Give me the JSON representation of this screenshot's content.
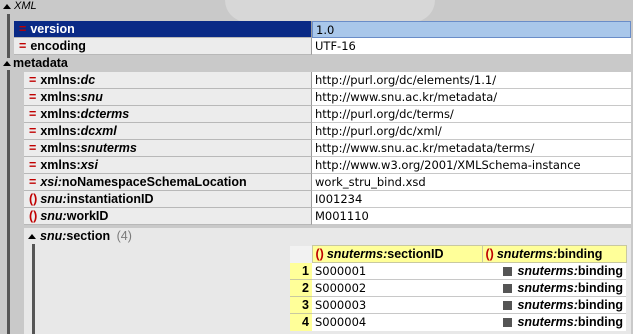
{
  "root": {
    "name": "XML"
  },
  "rows_top": [
    {
      "marker": "=",
      "prefix": "",
      "name": "version",
      "value": "1.0",
      "selected": true
    },
    {
      "marker": "=",
      "prefix": "",
      "name": "encoding",
      "value": "UTF-16",
      "selected": false
    }
  ],
  "metadata": {
    "label": "metadata",
    "rows": [
      {
        "marker": "=",
        "name": "xmlns:",
        "prefix": "dc",
        "value": "http://purl.org/dc/elements/1.1/"
      },
      {
        "marker": "=",
        "name": "xmlns:",
        "prefix": "snu",
        "value": "http://www.snu.ac.kr/metadata/"
      },
      {
        "marker": "=",
        "name": "xmlns:",
        "prefix": "dcterms",
        "value": "http://purl.org/dc/terms/"
      },
      {
        "marker": "=",
        "name": "xmlns:",
        "prefix": "dcxml",
        "value": "http://purl.org/dc/xml/"
      },
      {
        "marker": "=",
        "name": "xmlns:",
        "prefix": "snuterms",
        "value": "http://www.snu.ac.kr/metadata/terms/"
      },
      {
        "marker": "=",
        "name": "xmlns:",
        "prefix": "xsi",
        "value": "http://www.w3.org/2001/XMLSchema-instance"
      },
      {
        "marker": "=",
        "name": "noNamespaceSchemaLocation",
        "prefix": "xsi:",
        "value": "work_stru_bind.xsd"
      },
      {
        "marker": "()",
        "name": "instantiationID",
        "prefix": "snu:",
        "value": "I001234"
      },
      {
        "marker": "()",
        "name": "workID",
        "prefix": "snu:",
        "value": "M001110"
      }
    ]
  },
  "section": {
    "prefix": "snu:",
    "name": "section",
    "count": "(4)",
    "columns": [
      {
        "marker": "()",
        "prefix": "snuterms:",
        "name": "sectionID"
      },
      {
        "marker": "()",
        "prefix": "snuterms:",
        "name": "binding"
      }
    ],
    "rows": [
      {
        "index": "1",
        "sectionID": "S000001",
        "binding_prefix": "snuterms:",
        "binding": "binding"
      },
      {
        "index": "2",
        "sectionID": "S000002",
        "binding_prefix": "snuterms:",
        "binding": "binding"
      },
      {
        "index": "3",
        "sectionID": "S000003",
        "binding_prefix": "snuterms:",
        "binding": "binding"
      },
      {
        "index": "4",
        "sectionID": "S000004",
        "binding_prefix": "snuterms:",
        "binding": "binding"
      }
    ]
  }
}
